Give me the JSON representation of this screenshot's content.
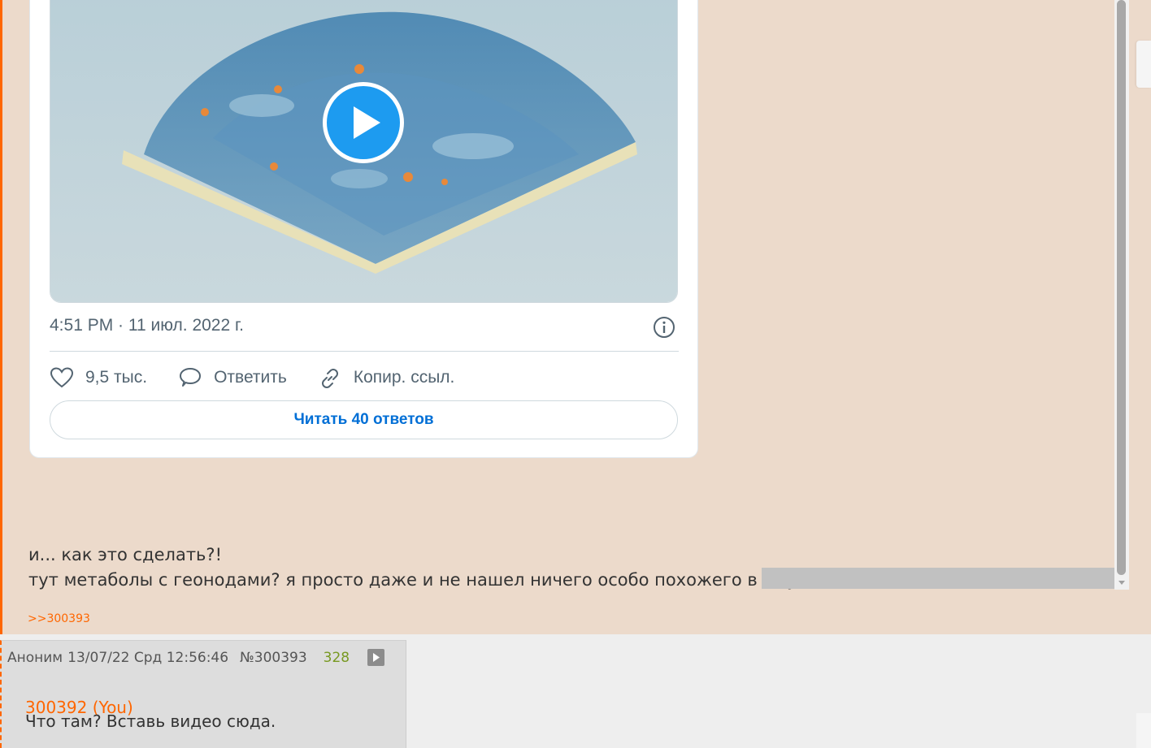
{
  "tweet": {
    "timestamp": "4:51 PM · 11 июл. 2022 г.",
    "likes": "9,5 тыс.",
    "reply_label": "Ответить",
    "copy_link_label": "Копир. ссыл.",
    "read_replies_label": "Читать 40 ответов",
    "accent_color": "#1d9bf0",
    "link_color": "#006fd6"
  },
  "op_post": {
    "line1": "и... как это сделать?!",
    "line2": "тут метаболы с геонодами? я просто даже и не нашел ничего особо похожего в ютубе",
    "backlink": ">>300393",
    "accent_color": "#ff6600"
  },
  "reply_post": {
    "author": "Аноним",
    "date": "13/07/22 Срд 12:56:46",
    "number": "№300393",
    "views": "328",
    "quote": "300392 (You)",
    "text": "Что там? Вставь видео сюда."
  },
  "icons": [
    "play-icon",
    "info-icon",
    "heart-icon",
    "comment-icon",
    "link-icon",
    "chevron-down-icon",
    "media-play-icon"
  ]
}
